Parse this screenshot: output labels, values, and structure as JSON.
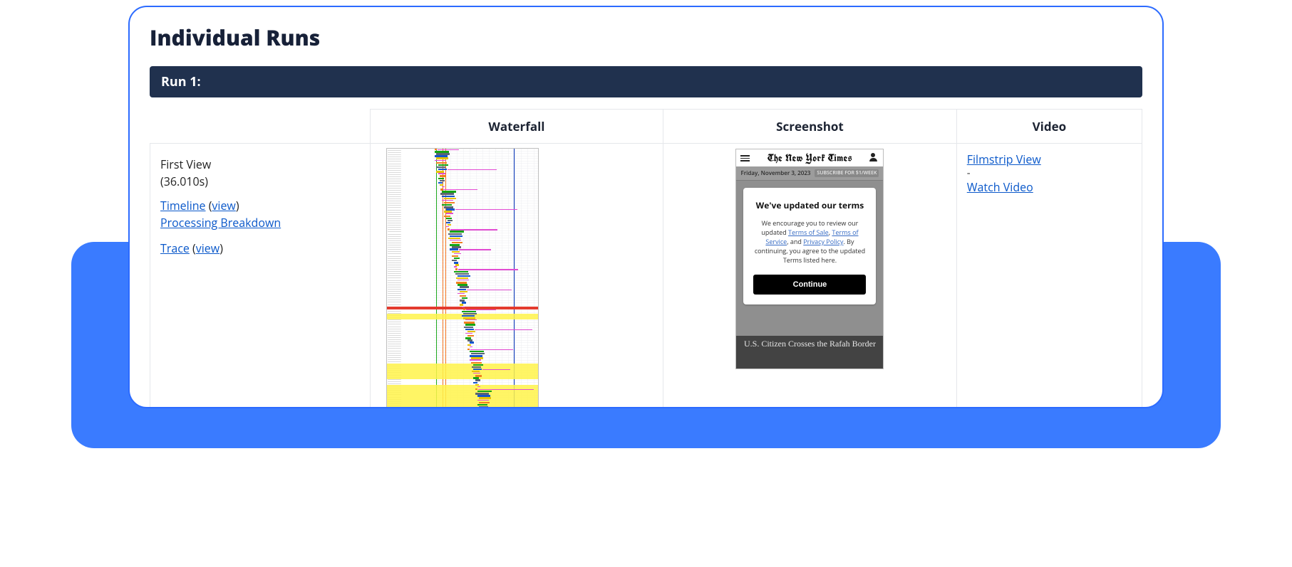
{
  "title": "Individual Runs",
  "run_header": "Run 1:",
  "columns": {
    "waterfall": "Waterfall",
    "screenshot": "Screenshot",
    "video": "Video"
  },
  "meta": {
    "first_view_label": "First View",
    "first_view_time": "(36.010s)",
    "timeline": "Timeline",
    "timeline_view": "view",
    "processing_breakdown": "Processing Breakdown",
    "trace": "Trace",
    "trace_view": "view"
  },
  "video": {
    "filmstrip": "Filmstrip View",
    "watch": "Watch Video"
  },
  "screenshot_content": {
    "masthead": "The New York Times",
    "date": "Friday, November 3, 2023",
    "subscribe": "SUBSCRIBE FOR $1/WEEK",
    "modal_title": "We've updated our terms",
    "modal_body_1": "We encourage you to review our updated ",
    "modal_link_tos": "Terms of Sale",
    "modal_sep1": ", ",
    "modal_link_tosvc": "Terms of Service",
    "modal_sep2": ", and ",
    "modal_link_pp": "Privacy Policy",
    "modal_body_2": ". By continuing, you agree to the updated Terms listed here.",
    "continue": "Continue",
    "headline": "U.S. Citizen Crosses the Rafah Border"
  }
}
